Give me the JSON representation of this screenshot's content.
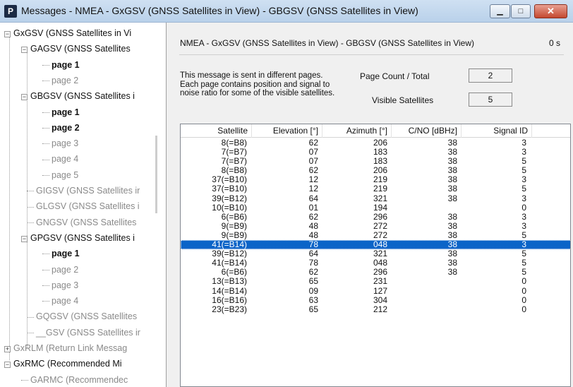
{
  "window": {
    "title": "Messages - NMEA - GxGSV (GNSS Satellites in View) - GBGSV (GNSS Satellites in View)",
    "min_label": "▁",
    "max_label": "□",
    "close_label": "✕",
    "app_icon": "P"
  },
  "tree": [
    {
      "label": "GxGSV (GNSS Satellites in Vi",
      "style": "normal",
      "expander": "−"
    },
    {
      "label": "GAGSV (GNSS Satellites",
      "style": "normal",
      "expander": "−"
    },
    {
      "label": "page 1",
      "style": "bold"
    },
    {
      "label": "page 2",
      "style": "dim"
    },
    {
      "label": "GBGSV (GNSS Satellites i",
      "style": "normal",
      "expander": "−"
    },
    {
      "label": "page 1",
      "style": "bold"
    },
    {
      "label": "page 2",
      "style": "bold"
    },
    {
      "label": "page 3",
      "style": "dim"
    },
    {
      "label": "page 4",
      "style": "dim"
    },
    {
      "label": "page 5",
      "style": "dim"
    },
    {
      "label": "GIGSV (GNSS Satellites ir",
      "style": "dim"
    },
    {
      "label": "GLGSV (GNSS Satellites i",
      "style": "dim"
    },
    {
      "label": "GNGSV (GNSS Satellites",
      "style": "dim"
    },
    {
      "label": "GPGSV (GNSS Satellites i",
      "style": "normal",
      "expander": "−"
    },
    {
      "label": "page 1",
      "style": "bold"
    },
    {
      "label": "page 2",
      "style": "dim"
    },
    {
      "label": "page 3",
      "style": "dim"
    },
    {
      "label": "page 4",
      "style": "dim"
    },
    {
      "label": "GQGSV (GNSS Satellites",
      "style": "dim"
    },
    {
      "label": "__GSV (GNSS Satellites ir",
      "style": "dim"
    },
    {
      "label": "GxRLM (Return Link Messag",
      "style": "dim",
      "expander": "+"
    },
    {
      "label": "GxRMC (Recommended Mi",
      "style": "normal",
      "expander": "−"
    },
    {
      "label": "GARMC (Recommendec",
      "style": "dim"
    }
  ],
  "panel": {
    "header": "NMEA - GxGSV (GNSS Satellites in View) - GBGSV (GNSS Satellites in View)",
    "time": "0 s",
    "description_lines": [
      "This message is sent in different pages.",
      "Each page contains position and signal to",
      "noise ratio for some of the visible satellites."
    ],
    "page_count_label": "Page Count / Total",
    "page_count_value": "2",
    "visible_sats_label": "Visible Satellites",
    "visible_sats_value": "5"
  },
  "table": {
    "columns": [
      "Satellite",
      "Elevation [°]",
      "Azimuth [°]",
      "C/NO [dBHz]",
      "Signal ID"
    ],
    "rows": [
      [
        "8(=B8)",
        "62",
        "206",
        "38",
        "3"
      ],
      [
        "7(=B7)",
        "07",
        "183",
        "38",
        "3"
      ],
      [
        "7(=B7)",
        "07",
        "183",
        "38",
        "5"
      ],
      [
        "8(=B8)",
        "62",
        "206",
        "38",
        "5"
      ],
      [
        "37(=B10)",
        "12",
        "219",
        "38",
        "3"
      ],
      [
        "37(=B10)",
        "12",
        "219",
        "38",
        "5"
      ],
      [
        "39(=B12)",
        "64",
        "321",
        "38",
        "3"
      ],
      [
        "10(=B10)",
        "01",
        "194",
        "",
        "0"
      ],
      [
        "6(=B6)",
        "62",
        "296",
        "38",
        "3"
      ],
      [
        "9(=B9)",
        "48",
        "272",
        "38",
        "3"
      ],
      [
        "9(=B9)",
        "48",
        "272",
        "38",
        "5"
      ],
      [
        "41(=B14)",
        "78",
        "048",
        "38",
        "3"
      ],
      [
        "39(=B12)",
        "64",
        "321",
        "38",
        "5"
      ],
      [
        "41(=B14)",
        "78",
        "048",
        "38",
        "5"
      ],
      [
        "6(=B6)",
        "62",
        "296",
        "38",
        "5"
      ],
      [
        "13(=B13)",
        "65",
        "231",
        "",
        "0"
      ],
      [
        "14(=B14)",
        "09",
        "127",
        "",
        "0"
      ],
      [
        "16(=B16)",
        "63",
        "304",
        "",
        "0"
      ],
      [
        "23(=B23)",
        "65",
        "212",
        "",
        "0"
      ]
    ],
    "selected_row": 11
  },
  "colors": {
    "selection": "#0a64c8",
    "titlebar": "#cfe0f2",
    "close_button": "#c4482f"
  }
}
